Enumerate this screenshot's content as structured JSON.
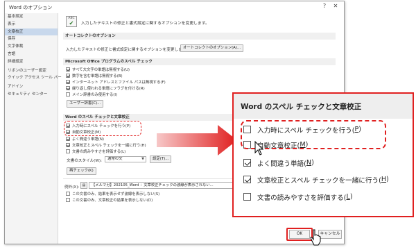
{
  "dialog": {
    "title": "Word のオプション",
    "help_symbol": "?",
    "close_symbol": "✕"
  },
  "sidebar": {
    "items": [
      {
        "label": "基本設定",
        "selected": false
      },
      {
        "label": "表示",
        "selected": false
      },
      {
        "label": "文章校正",
        "selected": true
      },
      {
        "label": "保存",
        "selected": false
      },
      {
        "label": "文字体裁",
        "selected": false
      },
      {
        "label": "言語",
        "selected": false
      },
      {
        "label": "詳細設定",
        "selected": false
      },
      {
        "label": "リボンのユーザー設定",
        "selected": false
      },
      {
        "label": "クイック アクセス ツール バー",
        "selected": false
      },
      {
        "label": "アドイン",
        "selected": false
      },
      {
        "label": "セキュリティ センター",
        "selected": false
      }
    ]
  },
  "main": {
    "intro": "入力したテキストの修正と書式設定に関するオプションを変更します。",
    "autocorrect": {
      "header": "オートコレクトのオプション",
      "desc": "入力したテキストの修正と書式設定に関するオプションを変更します。",
      "button": "オートコレクトのオプション(A)..."
    },
    "office": {
      "header": "Microsoft Office プログラムのスペル チェック",
      "options": [
        {
          "label": "すべて大文字の単語は無視する(U)",
          "checked": true
        },
        {
          "label": "数字を含む単語は無視する(B)",
          "checked": true
        },
        {
          "label": "インターネット アドレスとファイル パスは無視する(F)",
          "checked": true
        },
        {
          "label": "繰り返し使われる単語にフラグを付ける(R)",
          "checked": true
        },
        {
          "label": "メイン辞書のみ使用する(I)",
          "checked": false
        }
      ],
      "dict_button": "ユーザー辞書(C)..."
    },
    "word": {
      "header": "Word のスペル チェックと文章校正",
      "options": [
        {
          "label": "入力時にスペル チェックを行う(P)",
          "checked": true
        },
        {
          "label": "自動文章校正(M)",
          "checked": true
        },
        {
          "label": "よく間違う単語(N)",
          "checked": true
        },
        {
          "label": "文章校正とスペル チェックを一緒に行う(H)",
          "checked": true
        },
        {
          "label": "文書の読みやすさを評価する(L)",
          "checked": false
        }
      ],
      "style_label": "文書のスタイル(W):",
      "style_value": "通常の文",
      "settings_button": "設定(T)...",
      "recheck_button": "再チェック(K)"
    },
    "exceptions": {
      "label": "例外(X):",
      "doc_value": "【メルマガ】202105_Word ：文章校正チェックの波線が表示されない...",
      "options": [
        {
          "label": "この文書のみ、結果を表示せず波線を表示しない(S)",
          "checked": false
        },
        {
          "label": "この文書のみ、文章校正の結果を表示しない(D)",
          "checked": false
        }
      ]
    }
  },
  "footer": {
    "ok": "OK",
    "cancel": "キャンセル"
  },
  "zoom": {
    "title": "Word のスペル チェックと文章校正",
    "options": [
      {
        "label": "入力時にスペル チェックを行う(",
        "key": "P",
        "checked": false
      },
      {
        "label": "自動文章校正(",
        "key": "M",
        "checked": false
      },
      {
        "label": "よく間違う単語(",
        "key": "N",
        "checked": true
      },
      {
        "label": "文章校正とスペル チェックを一緒に行う(",
        "key": "H",
        "checked": true
      },
      {
        "label": "文書の読みやすさを評価する(",
        "key": "L",
        "checked": false
      }
    ]
  },
  "colors": {
    "highlight": "#e02020",
    "selected_nav": "#c8d8ec",
    "section_bg": "#f0f0f0"
  }
}
